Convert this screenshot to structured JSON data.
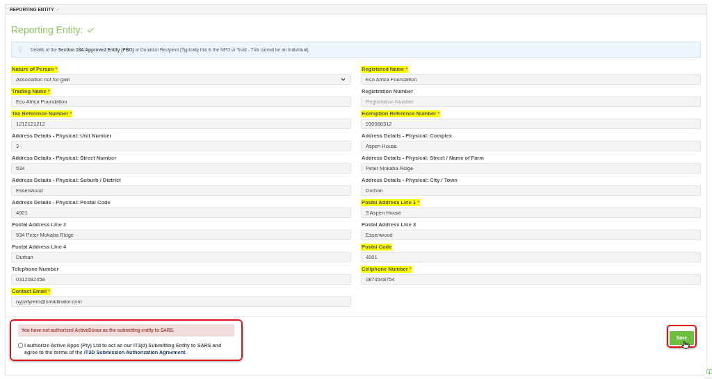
{
  "section_tab": {
    "label": "REPORTING ENTITY",
    "complete": true
  },
  "heading": {
    "text": "Reporting Entity:",
    "complete": true
  },
  "info": "Details of the **Section 18A Approved Entity (PBO)** or Donation Recipient (Typically this is the NPO or Trust - This cannot be an Individual)",
  "left_fields": [
    {
      "kind": "select",
      "label": "Nature of Person",
      "required_mark": "*",
      "highlighted": true,
      "value": "Association not for gain"
    },
    {
      "kind": "text",
      "label": "Trading Name",
      "required_mark": "*",
      "highlighted": true,
      "value": "Eco Africa Foundation"
    },
    {
      "kind": "text",
      "label": "Tax Reference Number",
      "required_mark": "*",
      "highlighted": true,
      "value": "1212121212"
    },
    {
      "kind": "text",
      "label": "Address Details - Physical: Unit Number",
      "highlighted": false,
      "value": "3"
    },
    {
      "kind": "text",
      "label": "Address Details - Physical: Street Number",
      "highlighted": false,
      "value": "534"
    },
    {
      "kind": "text",
      "label": "Address Details - Physical: Suburb / District",
      "highlighted": false,
      "value": "Essenwood"
    },
    {
      "kind": "text",
      "label": "Address Details - Physical: Postal Code",
      "highlighted": false,
      "value": "4001"
    },
    {
      "kind": "text",
      "label": "Postal Address Line 2",
      "highlighted": false,
      "value": "534 Peter Mokaba Ridge"
    },
    {
      "kind": "text",
      "label": "Postal Address Line 4",
      "highlighted": false,
      "value": "Durban"
    },
    {
      "kind": "text",
      "label": "Telephone Number",
      "highlighted": false,
      "value": "0312082458"
    },
    {
      "kind": "text",
      "label": "Contact Email",
      "required_mark": "*",
      "highlighted": true,
      "value": "nypafyrem@smailinator.com"
    }
  ],
  "right_fields": [
    {
      "kind": "text",
      "label": "Registered Name",
      "required_mark": "*",
      "highlighted": true,
      "value": "Eco Africa Foundation"
    },
    {
      "kind": "text",
      "label": "Registration Number",
      "highlighted": false,
      "placeholder": "Registration Number"
    },
    {
      "kind": "text",
      "label": "Exemption Reference Number",
      "required_mark": "*",
      "highlighted": true,
      "value": "930066312"
    },
    {
      "kind": "text",
      "label": "Address Details - Physical: Complex",
      "highlighted": false,
      "value": "Aspen House"
    },
    {
      "kind": "text",
      "label": "Address Details - Physical: Street / Name of Farm",
      "highlighted": false,
      "value": "Peter Mokaba Ridge"
    },
    {
      "kind": "text",
      "label": "Address Details - Physical: City / Town",
      "highlighted": false,
      "value": "Durban"
    },
    {
      "kind": "text",
      "label": "Postal Address Line 1",
      "required_mark": "*",
      "highlighted": true,
      "value": "3 Aspen House"
    },
    {
      "kind": "text",
      "label": "Postal Address Line 3",
      "highlighted": false,
      "value": "Essenwood"
    },
    {
      "kind": "text",
      "label": "Postal Code",
      "highlighted": true,
      "value": "4001"
    },
    {
      "kind": "text",
      "label": "Cellphone Number",
      "required_mark": "*",
      "highlighted": true,
      "value": "0873548754"
    }
  ],
  "alert": "You have not authorized ActiveDonor as the submitting entity to SARS.",
  "consent": {
    "checked": false,
    "text": "I authorize Active Apps (Pty) Ltd to act as our IT3(d) Submitting Entity to SARS and agree to the terms of the ",
    "link": "IT3D Submission Authorization Agreement",
    "end": "."
  },
  "save_button": "Save"
}
